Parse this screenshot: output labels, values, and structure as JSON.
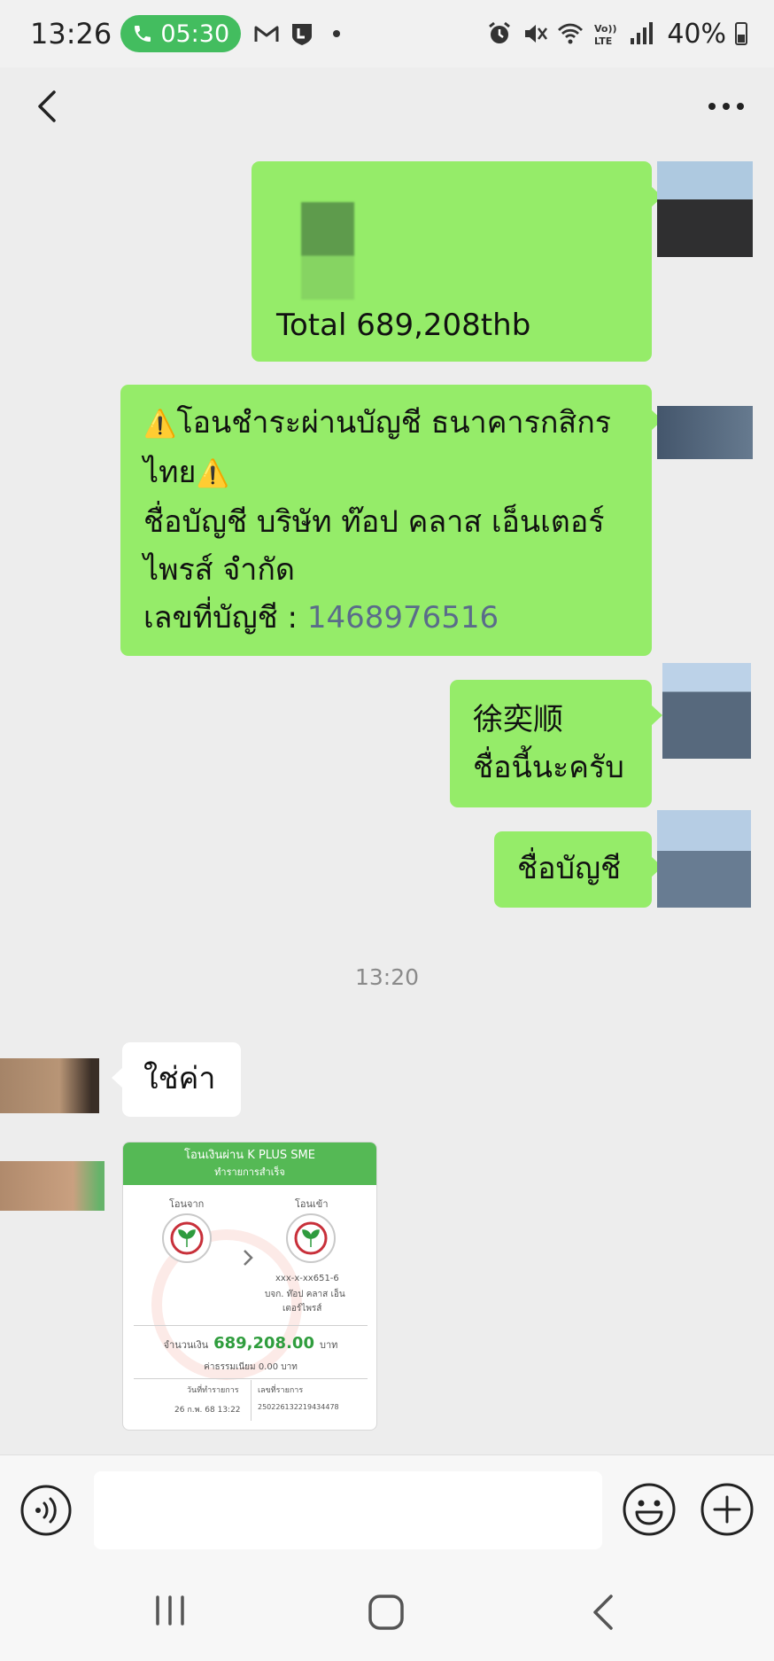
{
  "status_bar": {
    "time": "13:26",
    "call_duration": "05:30",
    "battery": "40%"
  },
  "messages": {
    "total_line": "Total 689,208thb",
    "bank_line_1": "โอนชำระผ่านบัญชี ธนาคารกสิกร",
    "bank_line_2": "ไทย",
    "account_name_line_1": "ชื่อบัญชี บริษัท ท๊อป คลาส เอ็นเตอร์",
    "account_name_line_2": "ไพรส์ จำกัด",
    "account_number_label": "เลขที่บัญชี : ",
    "account_number": "1468976516",
    "name_line_1": "徐奕顺",
    "name_line_2": "ชื่อนี้นะครับ",
    "account_name_short": "ชื่อบัญชี",
    "timestamp": "13:20",
    "reply_yes": "ใช่ค่า"
  },
  "slip": {
    "title": "โอนเงินผ่าน K PLUS SME",
    "subtitle": "ทำรายการสำเร็จ",
    "from_label": "โอนจาก",
    "to_label": "โอนเข้า",
    "to_account": "xxx-x-xx651-6",
    "to_name_1": "บจก. ท๊อป คลาส เอ็น",
    "to_name_2": "เตอร์ไพรส์",
    "amount_label": "จำนวนเงิน",
    "amount": "689,208.00",
    "amount_unit": "บาท",
    "fee_label": "ค่าธรรมเนียม",
    "fee": "0.00",
    "fee_unit": "บาท",
    "date_label": "วันที่ทำรายการ",
    "date": "26 ก.พ. 68 13:22",
    "ref_label": "เลขที่รายการ",
    "ref": "250226132219434478"
  },
  "colors": {
    "bubble_out": "#95ec69",
    "bubble_in": "#ffffff",
    "chat_bg": "#ededed",
    "call_pill": "#43bd5f",
    "slip_header": "#55b955"
  },
  "icons": [
    "phone-icon",
    "gmail-icon",
    "line-icon",
    "alarm-icon",
    "mute-icon",
    "wifi-icon",
    "volte-icon",
    "signal-icon",
    "battery-icon",
    "back-arrow-icon",
    "more-icon",
    "warning-icon",
    "voice-icon",
    "emoji-icon",
    "plus-icon",
    "recents-icon",
    "home-icon",
    "nav-back-icon"
  ]
}
